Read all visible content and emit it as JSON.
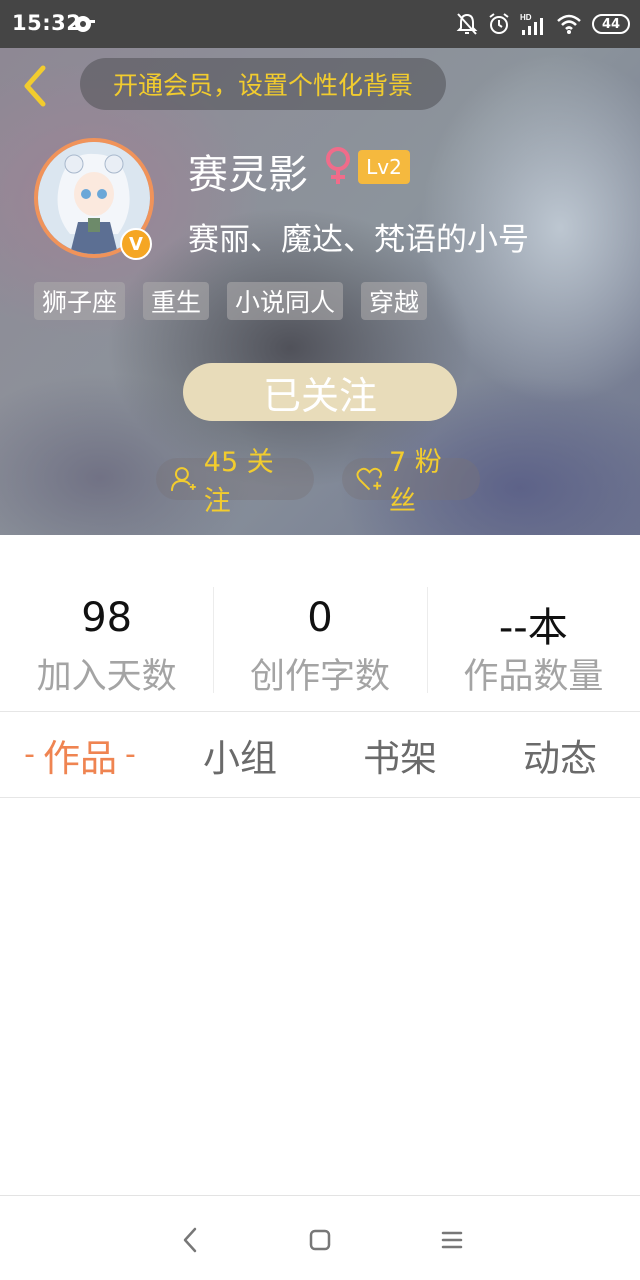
{
  "status_bar": {
    "time": "15:32",
    "battery": "44",
    "icons": [
      "media-icon",
      "bell-off-icon",
      "alarm-icon",
      "signal-icon",
      "wifi-icon",
      "battery-icon"
    ]
  },
  "header": {
    "promo_text": "开通会员，设置个性化背景",
    "username": "赛灵影",
    "gender": "female",
    "level": "Lv2",
    "verified_badge": "V",
    "bio": "赛丽、魔达、梵语的小号",
    "tags": [
      "狮子座",
      "重生",
      "小说同人",
      "穿越"
    ],
    "follow_button": "已关注",
    "following_text": "45 关注",
    "fans_text": "7 粉丝"
  },
  "stats": [
    {
      "value": "98",
      "label": "加入天数"
    },
    {
      "value": "0",
      "label": "创作字数"
    },
    {
      "value": "--本",
      "label": "作品数量"
    }
  ],
  "tabs": [
    {
      "label": "作品",
      "active": true
    },
    {
      "label": "小组",
      "active": false
    },
    {
      "label": "书架",
      "active": false
    },
    {
      "label": "动态",
      "active": false
    }
  ],
  "colors": {
    "accent": "#ef8451",
    "gold_text": "#f2cc2e",
    "follow_button": "#e8dcba",
    "level_badge": "#f5b93e"
  }
}
